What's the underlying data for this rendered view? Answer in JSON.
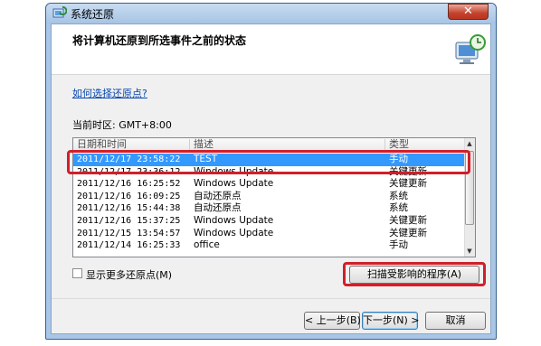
{
  "window": {
    "title": "系统还原",
    "close_label": "✕"
  },
  "header": {
    "heading": "将计算机还原到所选事件之前的状态"
  },
  "help_link": "如何选择还原点?",
  "timezone": "当前时区: GMT+8:00",
  "list": {
    "columns": [
      "日期和时间",
      "描述",
      "类型"
    ],
    "rows": [
      {
        "date": "2011/12/17 23:58:22",
        "desc": "TEST",
        "type": "手动",
        "selected": true
      },
      {
        "date": "2011/12/17 23:36:12",
        "desc": "Windows Update",
        "type": "关键更新",
        "selected": false
      },
      {
        "date": "2011/12/16 16:25:52",
        "desc": "Windows Update",
        "type": "关键更新",
        "selected": false
      },
      {
        "date": "2011/12/16 16:09:25",
        "desc": "自动还原点",
        "type": "系统",
        "selected": false
      },
      {
        "date": "2011/12/16 15:44:38",
        "desc": "自动还原点",
        "type": "系统",
        "selected": false
      },
      {
        "date": "2011/12/16 15:37:25",
        "desc": "Windows Update",
        "type": "关键更新",
        "selected": false
      },
      {
        "date": "2011/12/15 13:54:57",
        "desc": "Windows Update",
        "type": "关键更新",
        "selected": false
      },
      {
        "date": "2011/12/14 16:25:33",
        "desc": "office",
        "type": "手动",
        "selected": false
      }
    ]
  },
  "show_more": {
    "label": "显示更多还原点(M)",
    "checked": false
  },
  "buttons": {
    "scan": "扫描受影响的程序(A)",
    "back": "< 上一步(B)",
    "next": "下一步(N) >",
    "cancel": "取消"
  },
  "colors": {
    "selection": "#3399ff",
    "annotation_red": "#d0202a",
    "frame": "#a9c6e6"
  }
}
